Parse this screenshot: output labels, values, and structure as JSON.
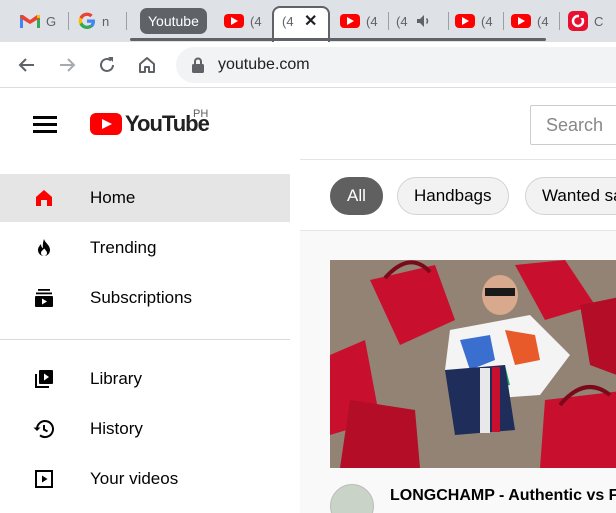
{
  "browser": {
    "tabs": [
      {
        "favicon": "gmail-icon",
        "title": "G"
      },
      {
        "favicon": "google-icon",
        "title": "n"
      },
      {
        "favicon": "youtube-icon",
        "title": "(4"
      },
      {
        "favicon": "youtube-icon",
        "title": "(4"
      },
      {
        "favicon": "youtube-icon",
        "title": "(4"
      },
      {
        "favicon": "youtube-icon",
        "title": "(4"
      },
      {
        "favicon": "youtube-icon",
        "title": "(4"
      },
      {
        "favicon": "youtube-icon",
        "title": "(4"
      },
      {
        "favicon": "red-app-icon",
        "title": "C"
      }
    ],
    "tab_group_label": "Youtube",
    "close_tab_glyph": "✕",
    "address": "youtube.com",
    "colors": {
      "tabstrip": "#dee1e6",
      "group": "#5f6368"
    }
  },
  "youtube": {
    "logo_text": "YouTube",
    "country_code": "PH",
    "search_placeholder": "Search",
    "sidebar": [
      {
        "label": "Home",
        "icon": "home-icon",
        "active": true
      },
      {
        "label": "Trending",
        "icon": "flame-icon"
      },
      {
        "label": "Subscriptions",
        "icon": "subscriptions-icon"
      },
      {
        "label": "Library",
        "icon": "library-icon"
      },
      {
        "label": "History",
        "icon": "history-icon"
      },
      {
        "label": "Your videos",
        "icon": "your-videos-icon"
      }
    ],
    "chips": [
      "All",
      "Handbags",
      "Wanted sa"
    ],
    "video": {
      "title": "LONGCHAMP - Authentic vs F"
    },
    "colors": {
      "brand_red": "#ff0000",
      "active_chip": "#606060"
    }
  }
}
